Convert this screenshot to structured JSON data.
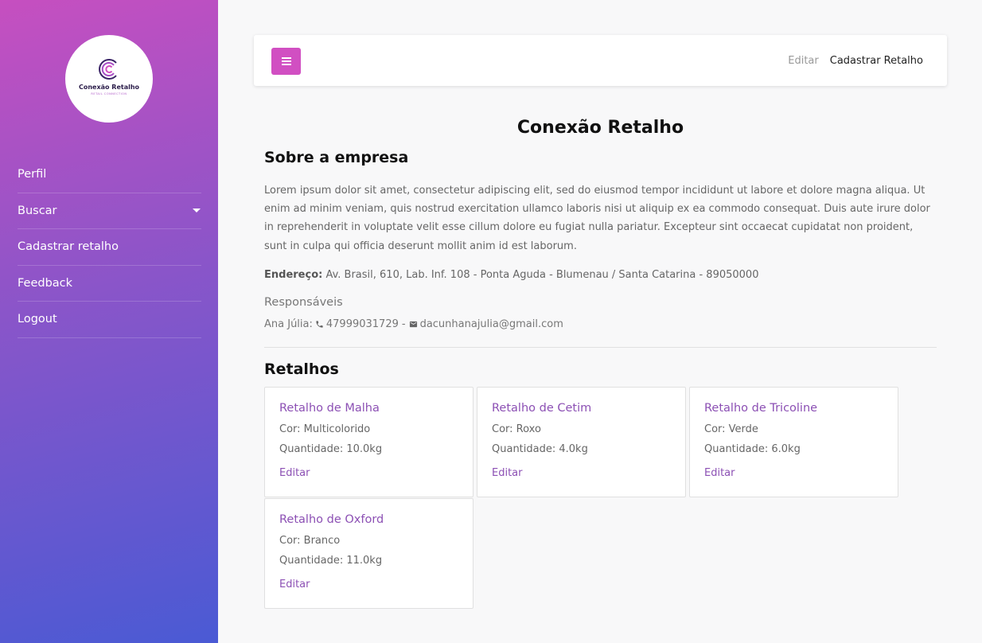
{
  "sidebar": {
    "logo": {
      "title": "Conexão Retalho",
      "subtitle": "RETAIL CONNECTION"
    },
    "items": [
      {
        "label": "Perfil"
      },
      {
        "label": "Buscar"
      },
      {
        "label": "Cadastrar retalho"
      },
      {
        "label": "Feedback"
      },
      {
        "label": "Logout"
      }
    ]
  },
  "topbar": {
    "menu_icon": "hamburger-icon",
    "links": [
      {
        "label": "Editar"
      },
      {
        "label": "Cadastrar Retalho"
      }
    ]
  },
  "main": {
    "title": "Conexão Retalho",
    "about_heading": "Sobre a empresa",
    "description": "Lorem ipsum dolor sit amet, consectetur adipiscing elit, sed do eiusmod tempor incididunt ut labore et dolore magna aliqua. Ut enim ad minim veniam, quis nostrud exercitation ullamco laboris nisi ut aliquip ex ea commodo consequat. Duis aute irure dolor in reprehenderit in voluptate velit esse cillum dolore eu fugiat nulla pariatur. Excepteur sint occaecat cupidatat non proident, sunt in culpa qui officia deserunt mollit anim id est laborum.",
    "address_label": "Endereço:",
    "address_value": "Av. Brasil, 610, Lab. Inf. 108 - Ponta Aguda - Blumenau / Santa Catarina - 89050000",
    "responsibles_heading": "Responsáveis",
    "responsible": {
      "name": "Ana Júlia:",
      "phone": "47999031729",
      "separator": "-",
      "email": "dacunhanajulia@gmail.com"
    },
    "retalhos_heading": "Retalhos",
    "retalhos": [
      {
        "title": "Retalho de Malha",
        "cor": "Cor: Multicolorido",
        "quantidade": "Quantidade: 10.0kg",
        "edit": "Editar"
      },
      {
        "title": "Retalho de Cetim",
        "cor": "Cor: Roxo",
        "quantidade": "Quantidade: 4.0kg",
        "edit": "Editar"
      },
      {
        "title": "Retalho de Tricoline",
        "cor": "Cor: Verde",
        "quantidade": "Quantidade: 6.0kg",
        "edit": "Editar"
      },
      {
        "title": "Retalho de Oxford",
        "cor": "Cor: Branco",
        "quantidade": "Quantidade: 11.0kg",
        "edit": "Editar"
      }
    ]
  },
  "colors": {
    "accent": "#d14fc2",
    "card_title": "#8c50b4",
    "sidebar_gradient_top": "#c64fc0",
    "sidebar_gradient_bottom": "#4a5ad4"
  }
}
